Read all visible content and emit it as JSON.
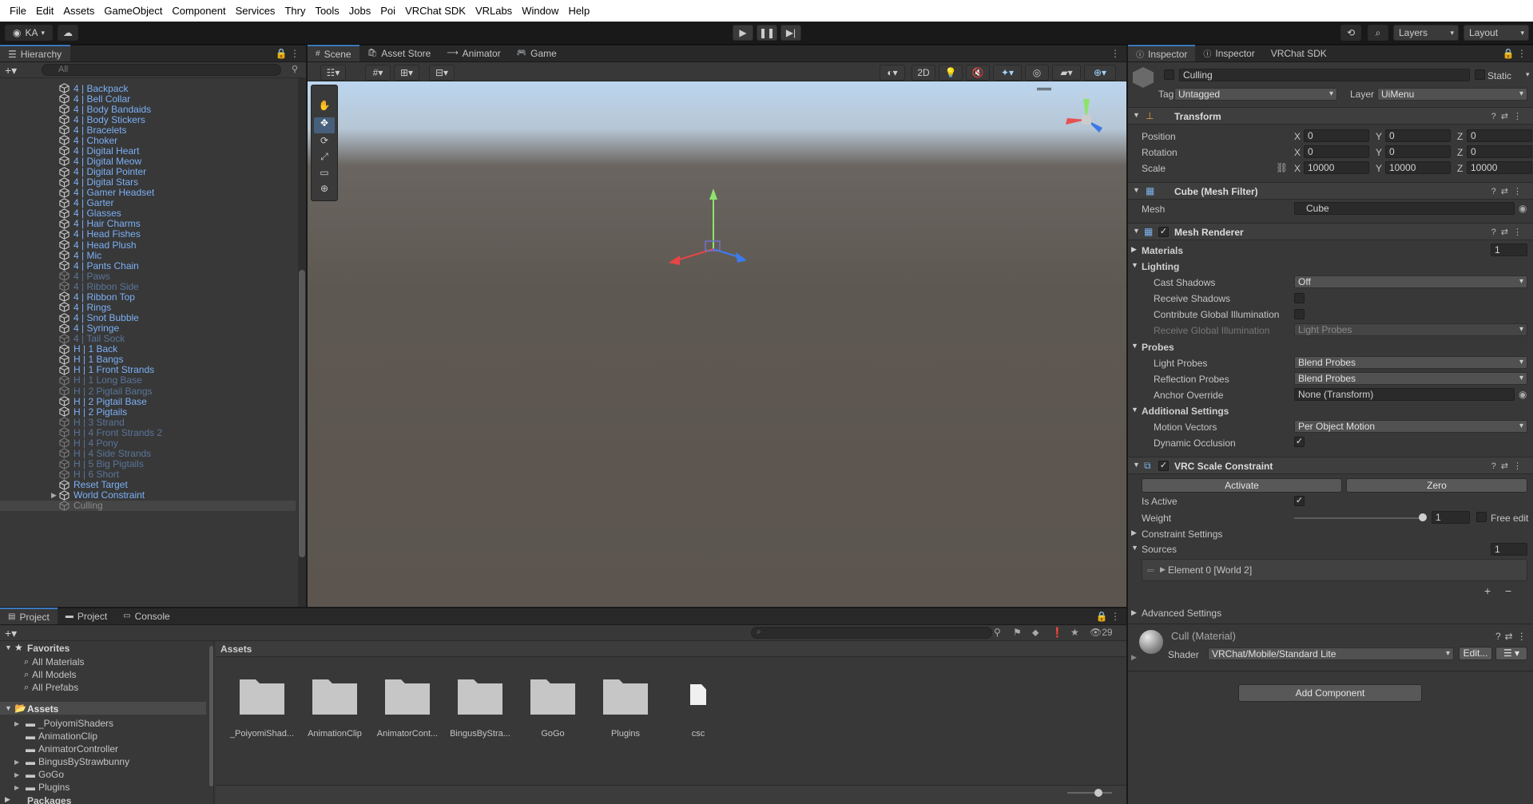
{
  "menu": [
    "File",
    "Edit",
    "Assets",
    "GameObject",
    "Component",
    "Services",
    "Thry",
    "Tools",
    "Jobs",
    "Poi",
    "VRChat SDK",
    "VRLabs",
    "Window",
    "Help"
  ],
  "toolbar": {
    "account": "KA",
    "layers": "Layers",
    "layout": "Layout"
  },
  "hierarchy": {
    "title": "Hierarchy",
    "search_placeholder": "All",
    "items": [
      {
        "label": "4 | Backpack",
        "dim": false
      },
      {
        "label": "4 | Bell Collar",
        "dim": false
      },
      {
        "label": "4 | Body Bandaids",
        "dim": false
      },
      {
        "label": "4 | Body Stickers",
        "dim": false
      },
      {
        "label": "4 | Bracelets",
        "dim": false
      },
      {
        "label": "4 | Choker",
        "dim": false
      },
      {
        "label": "4 | Digital Heart",
        "dim": false
      },
      {
        "label": "4 | Digital Meow",
        "dim": false
      },
      {
        "label": "4 | Digital Pointer",
        "dim": false
      },
      {
        "label": "4 | Digital Stars",
        "dim": false
      },
      {
        "label": "4 | Gamer Headset",
        "dim": false
      },
      {
        "label": "4 | Garter",
        "dim": false
      },
      {
        "label": "4 | Glasses",
        "dim": false
      },
      {
        "label": "4 | Hair Charms",
        "dim": false
      },
      {
        "label": "4 | Head Fishes",
        "dim": false
      },
      {
        "label": "4 | Head Plush",
        "dim": false
      },
      {
        "label": "4 | Mic",
        "dim": false
      },
      {
        "label": "4 | Pants Chain",
        "dim": false
      },
      {
        "label": "4 | Paws",
        "dim": true
      },
      {
        "label": "4 | Ribbon Side",
        "dim": true
      },
      {
        "label": "4 | Ribbon Top",
        "dim": false
      },
      {
        "label": "4 | Rings",
        "dim": false
      },
      {
        "label": "4 | Snot Bubble",
        "dim": false
      },
      {
        "label": "4 | Syringe",
        "dim": false
      },
      {
        "label": "4 | Tail Sock",
        "dim": true
      },
      {
        "label": "H | 1 Back",
        "dim": false
      },
      {
        "label": "H | 1 Bangs",
        "dim": false
      },
      {
        "label": "H | 1 Front Strands",
        "dim": false
      },
      {
        "label": "H | 1 Long Base",
        "dim": true
      },
      {
        "label": "H | 2 Pigtail Bangs",
        "dim": true
      },
      {
        "label": "H | 2 Pigtail Base",
        "dim": false
      },
      {
        "label": "H | 2 Pigtails",
        "dim": false
      },
      {
        "label": "H | 3 Strand",
        "dim": true
      },
      {
        "label": "H | 4 Front Strands 2",
        "dim": true
      },
      {
        "label": "H | 4 Pony",
        "dim": true
      },
      {
        "label": "H | 4 Side Strands",
        "dim": true
      },
      {
        "label": "H | 5 Big Pigtails",
        "dim": true
      },
      {
        "label": "H | 6 Short",
        "dim": true
      },
      {
        "label": "Reset Target",
        "dim": false
      },
      {
        "label": "World Constraint",
        "dim": false
      },
      {
        "label": "Culling",
        "dim": true
      }
    ]
  },
  "scene_tabs": [
    "Scene",
    "Asset Store",
    "Animator",
    "Game"
  ],
  "scene": {
    "mode_2d": "2D",
    "gizmo_y": "y"
  },
  "inspector": {
    "tabs": [
      "Inspector",
      "Inspector",
      "VRChat SDK"
    ],
    "object_name": "Culling",
    "static_label": "Static",
    "tag_label": "Tag",
    "tag_value": "Untagged",
    "layer_label": "Layer",
    "layer_value": "UiMenu",
    "transform": {
      "title": "Transform",
      "position_label": "Position",
      "rotation_label": "Rotation",
      "scale_label": "Scale",
      "position": [
        "0",
        "0",
        "0"
      ],
      "rotation": [
        "0",
        "0",
        "0"
      ],
      "scale": [
        "10000",
        "10000",
        "10000"
      ]
    },
    "mesh_filter": {
      "title": "Cube (Mesh Filter)",
      "mesh_label": "Mesh",
      "mesh_value": "Cube"
    },
    "mesh_renderer": {
      "title": "Mesh Renderer",
      "materials_label": "Materials",
      "materials_count": "1",
      "lighting": "Lighting",
      "cast_shadows_label": "Cast Shadows",
      "cast_shadows": "Off",
      "receive_shadows": "Receive Shadows",
      "contribute_gi": "Contribute Global Illumination",
      "receive_gi_label": "Receive Global Illumination",
      "receive_gi": "Light Probes",
      "probes": "Probes",
      "light_probes_label": "Light Probes",
      "light_probes": "Blend Probes",
      "reflection_probes_label": "Reflection Probes",
      "reflection_probes": "Blend Probes",
      "anchor_override_label": "Anchor Override",
      "anchor_override": "None (Transform)",
      "additional": "Additional Settings",
      "motion_vectors_label": "Motion Vectors",
      "motion_vectors": "Per Object Motion",
      "dynamic_occlusion": "Dynamic Occlusion"
    },
    "constraint": {
      "title": "VRC Scale Constraint",
      "activate": "Activate",
      "zero": "Zero",
      "is_active": "Is Active",
      "weight_label": "Weight",
      "weight": "1",
      "free_edit": "Free edit",
      "settings": "Constraint Settings",
      "sources": "Sources",
      "sources_count": "1",
      "element": "Element 0 [World 2]"
    },
    "advanced": "Advanced Settings",
    "material": {
      "name": "Cull (Material)",
      "shader_label": "Shader",
      "shader": "VRChat/Mobile/Standard Lite",
      "edit": "Edit..."
    },
    "add_component": "Add Component"
  },
  "project": {
    "tabs": [
      "Project",
      "Project",
      "Console"
    ],
    "hidden_count": "29",
    "favorites": "Favorites",
    "fav_items": [
      "All Materials",
      "All Models",
      "All Prefabs"
    ],
    "assets": "Assets",
    "tree": [
      "_PoiyomiShaders",
      "AnimationClip",
      "AnimatorController",
      "BingusByStrawbunny",
      "GoGo",
      "Plugins"
    ],
    "packages": "Packages",
    "breadcrumb": "Assets",
    "grid": [
      "_PoiyomiShad...",
      "AnimationClip",
      "AnimatorCont...",
      "BingusByStra...",
      "GoGo",
      "Plugins",
      "csc"
    ]
  }
}
